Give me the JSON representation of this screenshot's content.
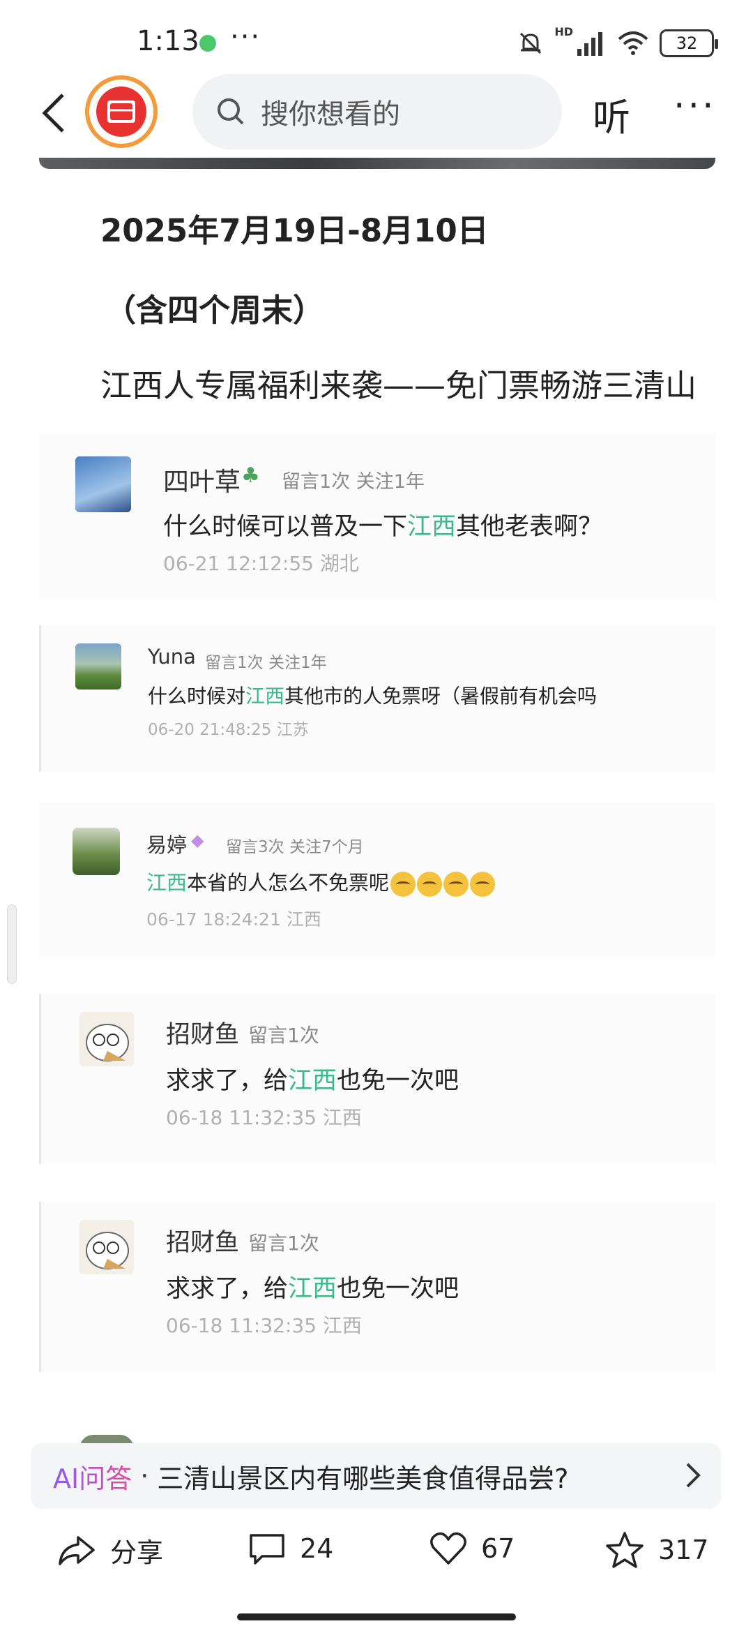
{
  "status_bar": {
    "time": "1:13",
    "more": "···",
    "signal_label": "HD",
    "battery": "32"
  },
  "nav": {
    "search_placeholder": "搜你想看的",
    "listen_label": "听",
    "more_label": "···"
  },
  "article": {
    "date_line": "2025年7月19日-8月10日",
    "weekend_line": "（含四个周末）",
    "benefit_line": "江西人专属福利来袭——免门票畅游三清山"
  },
  "comments": [
    {
      "name": "四叶草",
      "meta": "留言1次 关注1年",
      "text_before": "什么时候可以普及一下",
      "highlight": "江西",
      "text_after": "其他老表啊？",
      "time": "06-21 12:12:55 湖北"
    },
    {
      "name": "Yuna",
      "meta": "留言1次 关注1年",
      "text_before": "什么时候对",
      "highlight": "江西",
      "text_after": "其他市的人免票呀（暑假前有机会吗",
      "time": "06-20 21:48:25 江苏"
    },
    {
      "name": "易婷",
      "meta": "留言3次 关注7个月",
      "text_before": "",
      "highlight": "江西",
      "text_after": "本省的人怎么不免票呢",
      "time": "06-17 18:24:21 江西"
    },
    {
      "name": "招财鱼",
      "meta": "留言1次",
      "text_before": "求求了，给",
      "highlight": "江西",
      "text_after": "也免一次吧",
      "time": "06-18 11:32:35 江西"
    },
    {
      "name": "招财鱼",
      "meta": "留言1次",
      "text_before": "求求了，给",
      "highlight": "江西",
      "text_after": "也免一次吧",
      "time": "06-18 11:32:35 江西"
    }
  ],
  "ai_bar": {
    "label": "AI问答",
    "separator": "·",
    "question": "三清山景区内有哪些美食值得品尝?"
  },
  "actions": {
    "share": "分享",
    "comment_count": "24",
    "like_count": "67",
    "favorite_count": "317"
  }
}
